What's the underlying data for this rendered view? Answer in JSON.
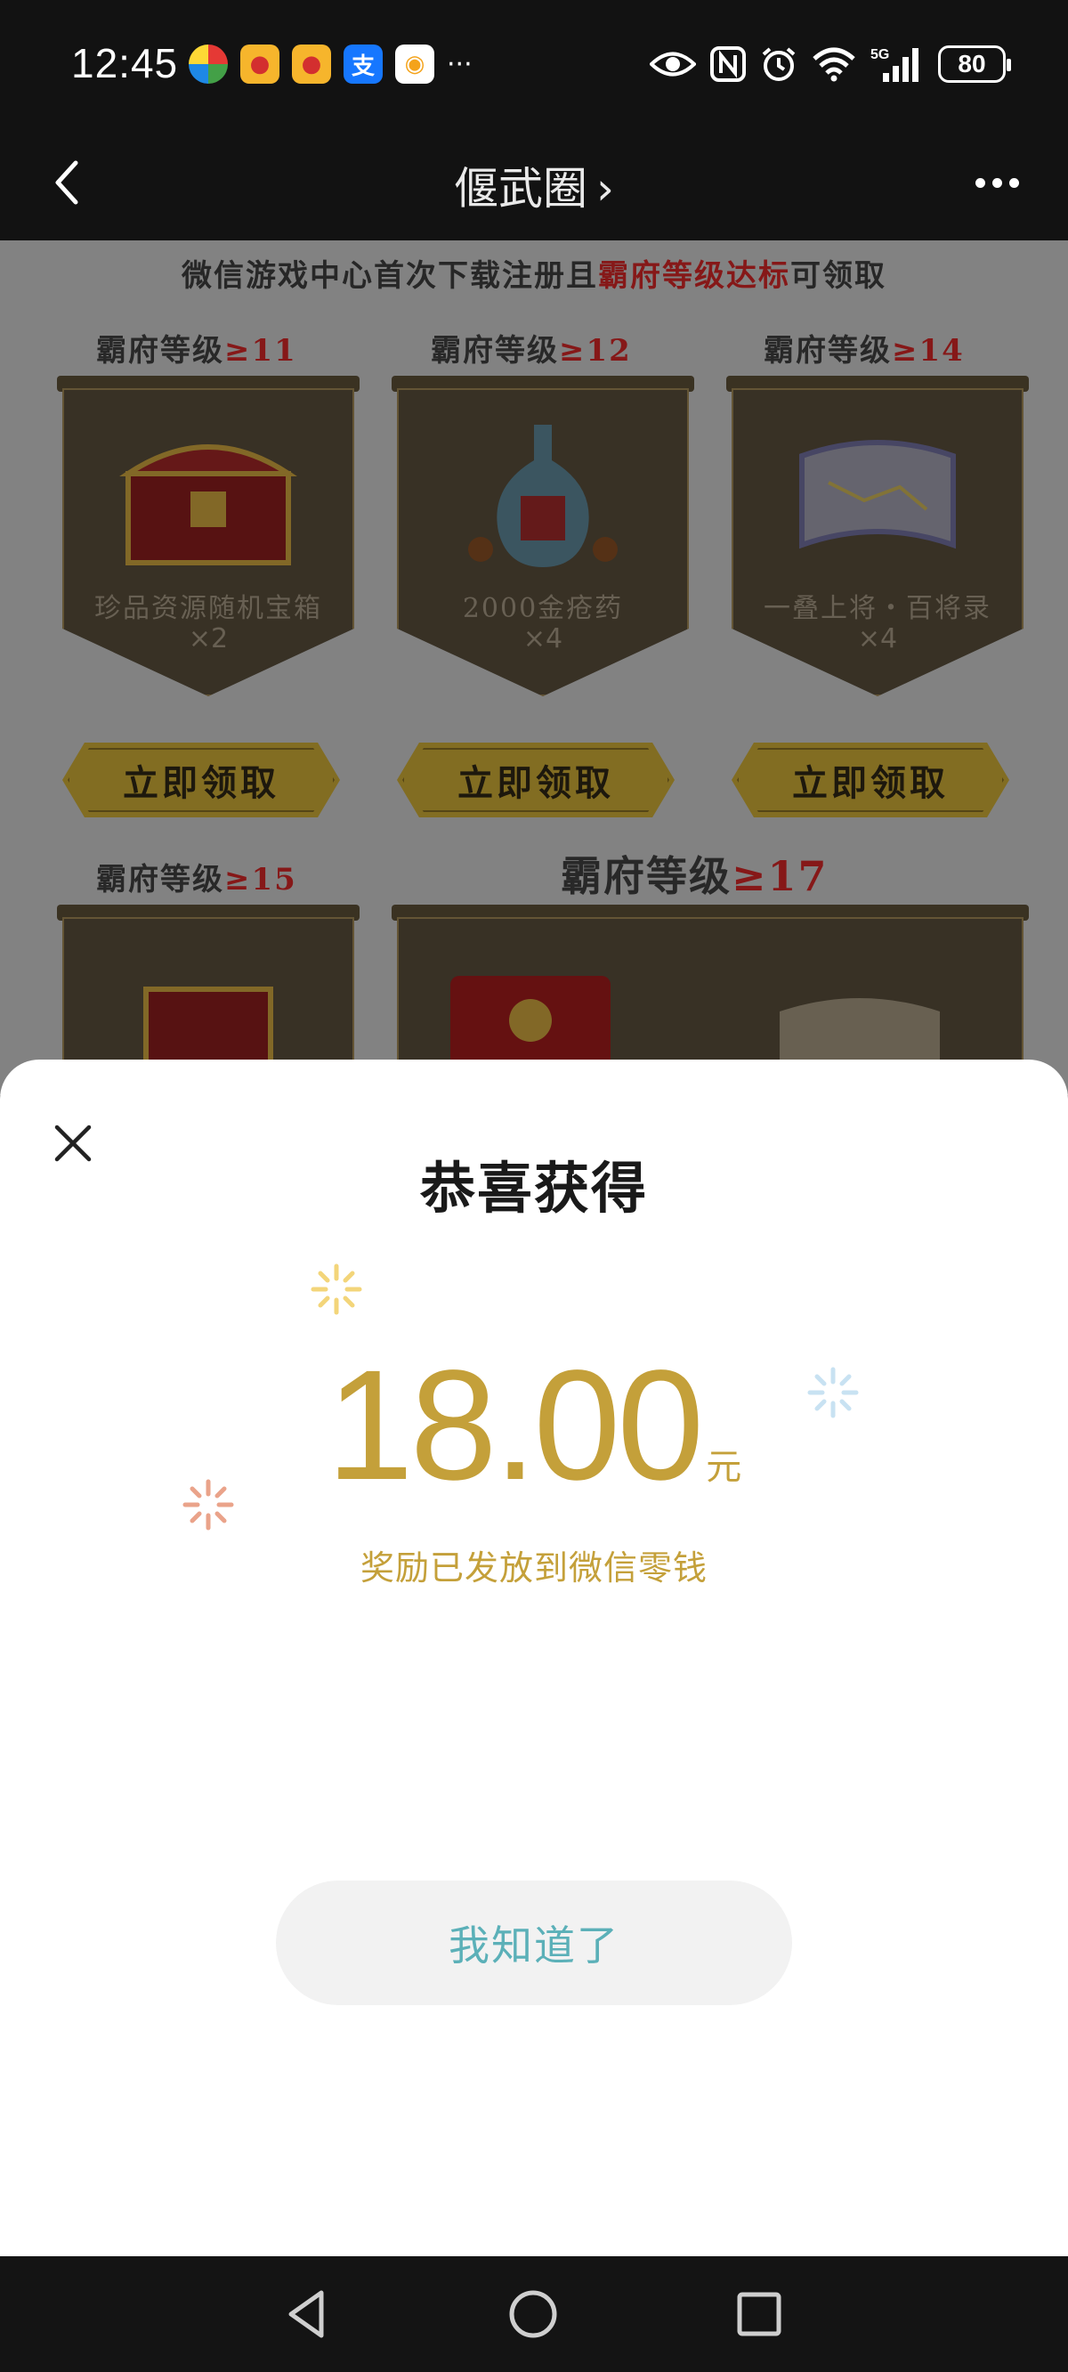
{
  "status_bar": {
    "time": "12:45",
    "notification_icons": [
      "multicolor-app-icon",
      "weibo-icon",
      "weibo-icon",
      "alipay-icon",
      "taobao-icon"
    ],
    "notification_glyphs": [
      "",
      "●",
      "●",
      "支",
      "◉"
    ],
    "more_indicator": "···",
    "system_icons": [
      "eye-icon",
      "nfc-icon",
      "alarm-icon",
      "wifi-icon",
      "signal-5g-icon"
    ],
    "network": "5G",
    "battery": "80"
  },
  "nav_bar": {
    "title": "偃武圈",
    "chevron": "›"
  },
  "background_page": {
    "banner_prefix": "微信游戏中心首次下载注册且",
    "banner_highlight": "霸府等级达标",
    "banner_suffix": "可领取",
    "level_prefix": "霸府等级",
    "rewards": [
      {
        "level": "≥11",
        "name": "珍品资源随机宝箱",
        "qty": "×2",
        "button": "立即领取"
      },
      {
        "level": "≥12",
        "name": "2000金疮药",
        "qty": "×4",
        "button": "立即领取"
      },
      {
        "level": "≥14",
        "name": "一叠上将・百将录",
        "qty": "×4",
        "button": "立即领取"
      }
    ],
    "level_15": "≥15",
    "level_17": "≥17"
  },
  "sheet": {
    "title": "恭喜获得",
    "amount": "18.00",
    "unit": "元",
    "note": "奖励已发放到微信零钱",
    "confirm_button": "我知道了"
  },
  "colors": {
    "gold": "#c4a03a",
    "teal": "#5bb0b8",
    "dark_red": "#8e1a1a"
  }
}
